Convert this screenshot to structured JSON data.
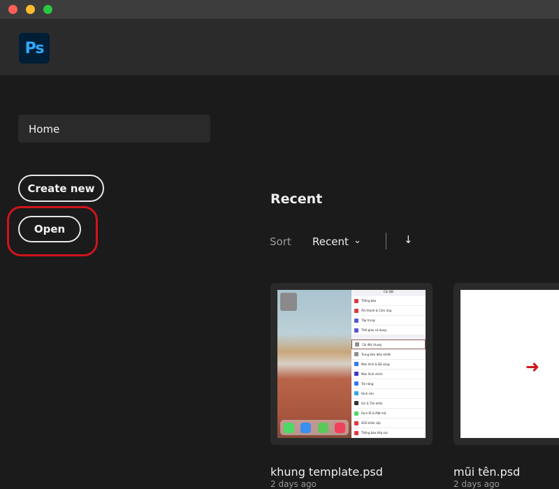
{
  "window": {
    "controls": [
      "close",
      "minimize",
      "maximize"
    ],
    "colors": {
      "close": "#ff5f57",
      "minimize": "#febc2e",
      "maximize": "#28c840"
    }
  },
  "app": {
    "logo_text": "Ps",
    "brand_color": "#31a8ff"
  },
  "sidebar": {
    "home_label": "Home",
    "create_new_label": "Create new",
    "open_label": "Open",
    "highlight_color": "#d0141c"
  },
  "main": {
    "section_title": "Recent",
    "sort_label": "Sort",
    "sort_value": "Recent",
    "sort_direction_icon": "arrow-down-icon",
    "files": [
      {
        "name": "khung template.psd",
        "date": "2 days ago"
      },
      {
        "name": "mũi tên.psd",
        "date": "2 days ago"
      }
    ],
    "thumbnail_settings": {
      "title": "Cài đặt",
      "items": [
        "Thông báo",
        "Âm thanh & Cảm ứng",
        "Tập trung",
        "Thời gian sử dụng",
        "Cài đặt chung",
        "Trung tâm điều khiển",
        "Màn hình & Độ sáng",
        "Màn hình chính",
        "Trợ năng",
        "Hình nền",
        "Siri & Tìm kiếm",
        "Face ID & Mật mã",
        "SOS khẩn cấp",
        "Thông báo tiếp xúc"
      ]
    }
  }
}
